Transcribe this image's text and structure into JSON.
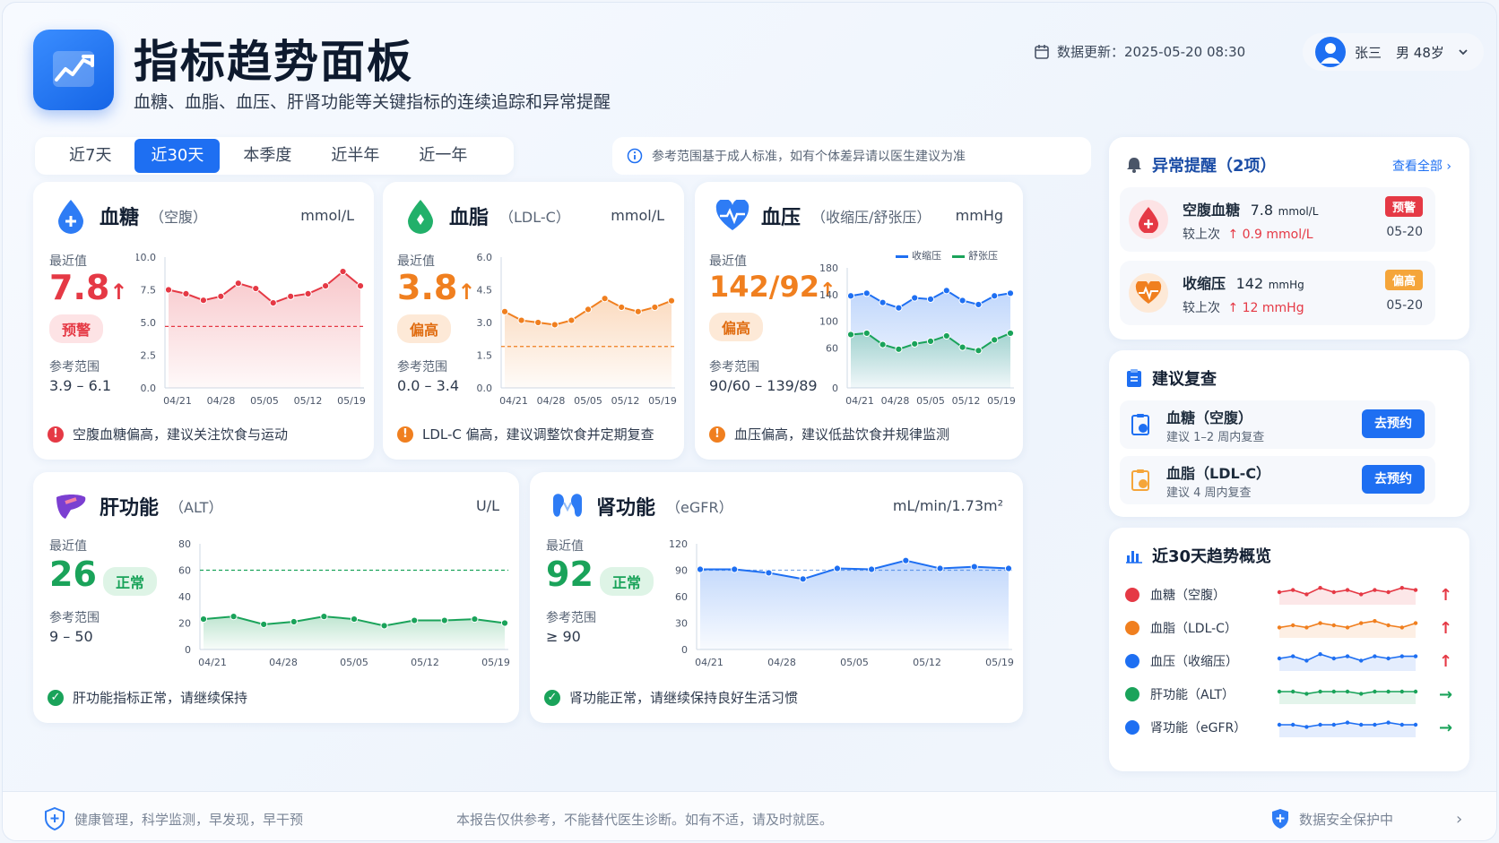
{
  "header": {
    "title": "指标趋势面板",
    "subtitle": "血糖、血脂、血压、肝肾功能等关键指标的连续追踪和异常提醒",
    "update_text": "数据更新：2025-05-20 08:30",
    "user_name": "张三",
    "user_info": "男 48岁"
  },
  "tabs": [
    "近7天",
    "近30天",
    "本季度",
    "近半年",
    "近一年"
  ],
  "active_tab": "近30天",
  "note": "参考范围基于成人标准，如有个体差异请以医生建议为准",
  "common": {
    "latest_label": "最近值",
    "ref_label": "参考范围"
  },
  "x_dates": [
    "04/21",
    "04/28",
    "05/05",
    "05/12",
    "05/19"
  ],
  "cards": {
    "glucose": {
      "title": "血糖",
      "sub": "（空腹）",
      "unit": "mmol/L",
      "value": "7.8",
      "arrow": "↑",
      "badge": "预警",
      "ref": "3.9 – 6.1",
      "message": "空腹血糖偏高，建议关注饮食与运动",
      "color": "#e53945"
    },
    "lipid": {
      "title": "血脂",
      "sub": "（LDL-C）",
      "unit": "mmol/L",
      "value": "3.8",
      "arrow": "↑",
      "badge": "偏高",
      "ref": "0.0 – 3.4",
      "message": "LDL-C 偏高，建议调整饮食并定期复查",
      "color": "#f07f1f"
    },
    "bp": {
      "title": "血压",
      "sub": "（收缩压/舒张压）",
      "unit": "mmHg",
      "value": "142/92",
      "arrow": "↑",
      "badge": "偏高",
      "ref": "90/60 – 139/89",
      "message": "血压偏高，建议低盐饮食并规律监测",
      "color": "#f07f1f",
      "legend": [
        "收缩压",
        "舒张压"
      ]
    },
    "liver": {
      "title": "肝功能",
      "sub": "（ALT）",
      "unit": "U/L",
      "value": "26",
      "badge": "正常",
      "ref": "9 – 50",
      "message": "肝功能指标正常，请继续保持",
      "color": "#1aa35a"
    },
    "kidney": {
      "title": "肾功能",
      "sub": "（eGFR）",
      "unit": "mL/min/1.73m²",
      "value": "92",
      "badge": "正常",
      "ref": "≥ 90",
      "message": "肾功能正常，请继续保持良好生活习惯",
      "color": "#1aa35a"
    }
  },
  "chart_data": [
    {
      "type": "line",
      "name_key": "glucose",
      "x": [
        "04/21",
        "04/28",
        "05/05",
        "05/12",
        "05/19"
      ],
      "yticks": [
        0,
        2.5,
        5.0,
        7.5,
        10.0
      ],
      "ylim": [
        0,
        10
      ],
      "ref_line": 4.7,
      "series": [
        {
          "values": [
            7.5,
            7.2,
            6.7,
            7.0,
            8.0,
            7.6,
            6.5,
            7.0,
            7.2,
            7.8,
            8.9,
            7.8
          ]
        }
      ]
    },
    {
      "type": "line",
      "name_key": "lipid",
      "x": [
        "04/21",
        "04/28",
        "05/05",
        "05/12",
        "05/19"
      ],
      "yticks": [
        0,
        1.5,
        3.0,
        4.5,
        6.0
      ],
      "ylim": [
        0,
        6
      ],
      "ref_line": 1.9,
      "series": [
        {
          "values": [
            3.5,
            3.1,
            3.0,
            2.9,
            3.1,
            3.6,
            4.1,
            3.7,
            3.5,
            3.7,
            4.0
          ]
        }
      ]
    },
    {
      "type": "line",
      "name_key": "bp",
      "x": [
        "04/21",
        "04/28",
        "05/05",
        "05/12",
        "05/19"
      ],
      "yticks": [
        0,
        60,
        100,
        140,
        180
      ],
      "ylim": [
        0,
        180
      ],
      "series": [
        {
          "name": "收缩压",
          "values": [
            138,
            142,
            128,
            120,
            135,
            133,
            146,
            131,
            125,
            138,
            142
          ],
          "color": "#1e6ff2"
        },
        {
          "name": "舒张压",
          "values": [
            80,
            82,
            65,
            58,
            66,
            70,
            78,
            61,
            56,
            72,
            82
          ],
          "color": "#1aa35a"
        }
      ]
    },
    {
      "type": "line",
      "name_key": "liver",
      "x": [
        "04/21",
        "04/28",
        "05/05",
        "05/12",
        "05/19"
      ],
      "yticks": [
        0,
        20,
        40,
        60,
        80
      ],
      "ylim": [
        0,
        80
      ],
      "ref_line": 60,
      "series": [
        {
          "values": [
            23,
            25,
            19,
            21,
            25,
            23,
            18,
            22,
            22,
            23,
            20
          ]
        }
      ]
    },
    {
      "type": "line",
      "name_key": "kidney",
      "x": [
        "04/21",
        "04/28",
        "05/05",
        "05/12",
        "05/19"
      ],
      "yticks": [
        0,
        30,
        60,
        90,
        120
      ],
      "ylim": [
        0,
        120
      ],
      "ref_line": 90,
      "series": [
        {
          "values": [
            91,
            91,
            87,
            80,
            92,
            91,
            101,
            92,
            94,
            92
          ]
        }
      ]
    }
  ],
  "alerts": {
    "title": "异常提醒（2项）",
    "view_all": "查看全部",
    "items": [
      {
        "name": "空腹血糖",
        "value": "7.8",
        "unit": "mmol/L",
        "badge": "预警",
        "change_label": "较上次",
        "change": "↑ 0.9 mmol/L",
        "date": "05-20",
        "badge_color": "#e53945"
      },
      {
        "name": "收缩压",
        "value": "142",
        "unit": "mmHg",
        "badge": "偏高",
        "change_label": "较上次",
        "change": "↑ 12 mmHg",
        "date": "05-20",
        "badge_color": "#f07f1f"
      }
    ]
  },
  "recheck": {
    "title": "建议复查",
    "items": [
      {
        "name": "血糖（空腹）",
        "desc": "建议 1–2 周内复查",
        "button": "去预约"
      },
      {
        "name": "血脂（LDL-C）",
        "desc": "建议 4 周内复查",
        "button": "去预约"
      }
    ]
  },
  "overview": {
    "title": "近30天趋势概览",
    "items": [
      {
        "name": "血糖（空腹）",
        "trend": "↑",
        "color": "#e53945",
        "trend_color": "#e53945",
        "values": [
          5,
          6,
          4,
          7,
          5,
          6,
          4,
          6,
          5,
          7,
          6
        ]
      },
      {
        "name": "血脂（LDL-C）",
        "trend": "↑",
        "color": "#f07f1f",
        "trend_color": "#e53945",
        "values": [
          4,
          5,
          4,
          6,
          5,
          4,
          6,
          7,
          5,
          4,
          6
        ]
      },
      {
        "name": "血压（收缩压）",
        "trend": "↑",
        "color": "#1e6ff2",
        "trend_color": "#e53945",
        "values": [
          5,
          6,
          4,
          7,
          5,
          6,
          4,
          6,
          5,
          6,
          6
        ]
      },
      {
        "name": "肝功能（ALT）",
        "trend": "→",
        "color": "#1aa35a",
        "trend_color": "#1aa35a",
        "values": [
          5,
          5,
          4,
          5,
          5,
          5,
          4,
          5,
          5,
          5,
          5
        ]
      },
      {
        "name": "肾功能（eGFR）",
        "trend": "→",
        "color": "#1e6ff2",
        "trend_color": "#1aa35a",
        "values": [
          5,
          5,
          4,
          5,
          5,
          6,
          5,
          5,
          6,
          5,
          5
        ]
      }
    ]
  },
  "footer": {
    "left": "健康管理，科学监测，早发现，早干预",
    "center": "本报告仅供参考，不能替代医生诊断。如有不适，请及时就医。",
    "right": "数据安全保护中"
  }
}
